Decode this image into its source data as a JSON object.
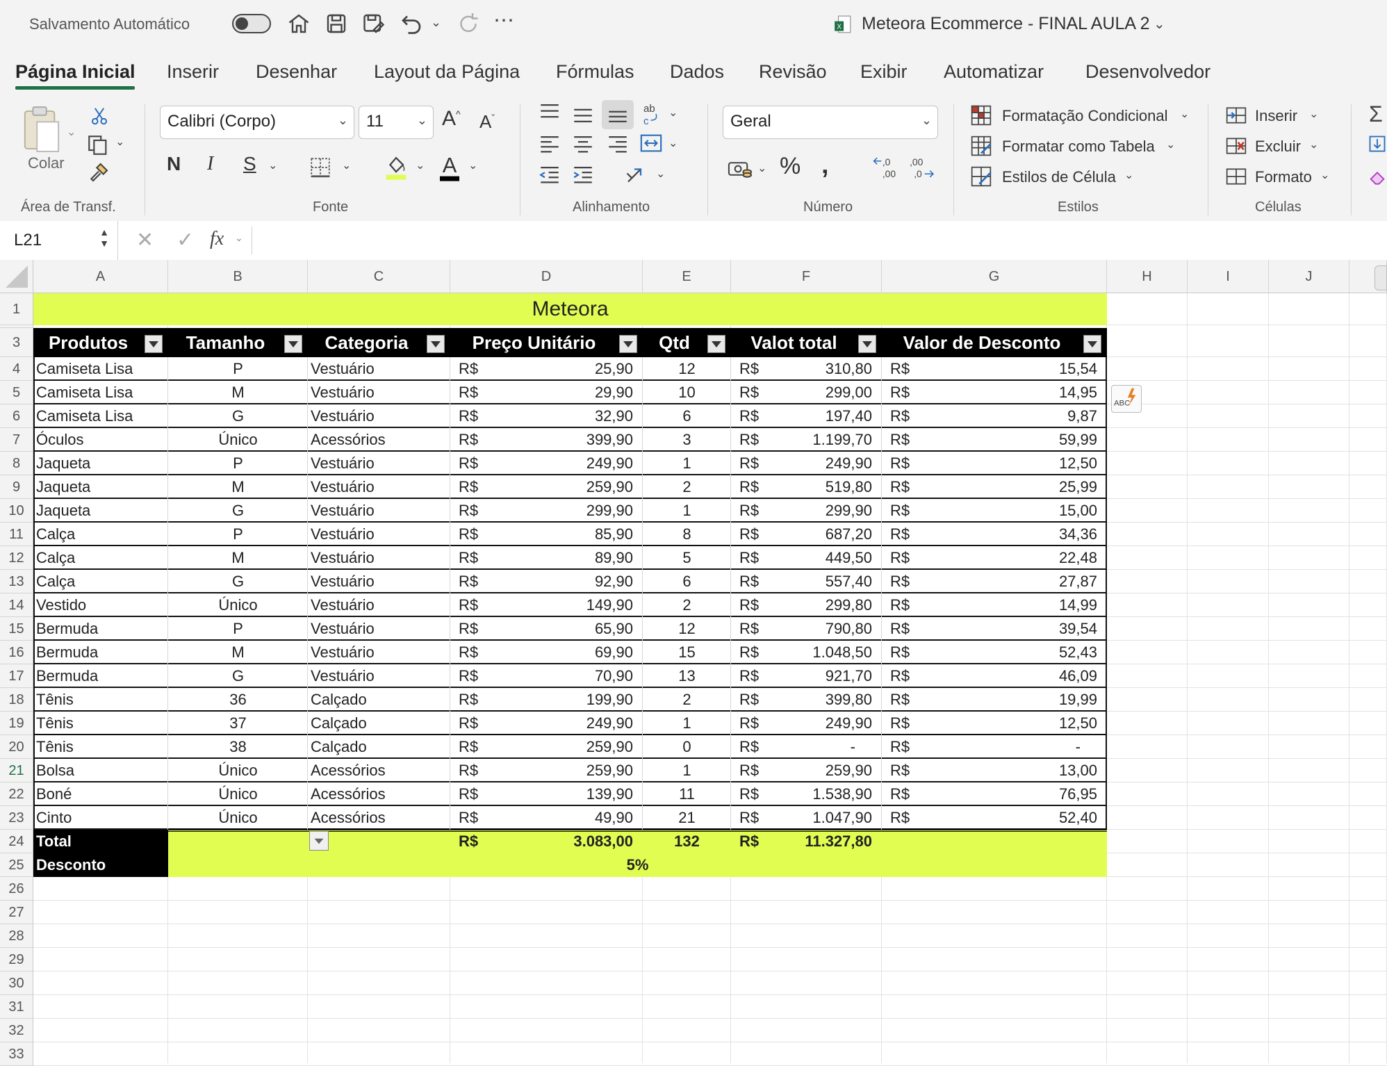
{
  "titlebar": {
    "autosave_label": "Salvamento Automático",
    "doc_title": "Meteora Ecommerce - FINAL AULA 2"
  },
  "tabs": [
    "Página Inicial",
    "Inserir",
    "Desenhar",
    "Layout da Página",
    "Fórmulas",
    "Dados",
    "Revisão",
    "Exibir",
    "Automatizar",
    "Desenvolvedor"
  ],
  "ribbon": {
    "clipboard": {
      "paste_label": "Colar",
      "group_label": "Área de Transf."
    },
    "font": {
      "font_name": "Calibri (Corpo)",
      "font_size": "11",
      "bold": "N",
      "italic": "I",
      "underline": "S",
      "group_label": "Fonte"
    },
    "alignment": {
      "group_label": "Alinhamento"
    },
    "number": {
      "format": "Geral",
      "percent": "%",
      "group_label": "Número"
    },
    "styles": {
      "conditional": "Formatação Condicional",
      "as_table": "Formatar como Tabela",
      "cell_styles": "Estilos de Célula",
      "group_label": "Estilos"
    },
    "cells": {
      "insert": "Inserir",
      "delete": "Excluir",
      "format": "Formato",
      "group_label": "Células"
    }
  },
  "formula_bar": {
    "name_box": "L21",
    "fx": "fx",
    "formula": ""
  },
  "sheet": {
    "columns": [
      "A",
      "B",
      "C",
      "D",
      "E",
      "F",
      "G",
      "H",
      "I",
      "J"
    ],
    "title": "Meteora",
    "headers": [
      "Produtos",
      "Tamanho",
      "Categoria",
      "Preço Unitário",
      "Qtd",
      "Valot total",
      "Valor de Desconto"
    ],
    "currency": "R$",
    "rows": [
      {
        "row": "4",
        "produto": "Camiseta Lisa",
        "tamanho": "P",
        "categoria": "Vestuário",
        "preco": "25,90",
        "qtd": "12",
        "total": "310,80",
        "desconto": "15,54"
      },
      {
        "row": "5",
        "produto": "Camiseta Lisa",
        "tamanho": "M",
        "categoria": "Vestuário",
        "preco": "29,90",
        "qtd": "10",
        "total": "299,00",
        "desconto": "14,95"
      },
      {
        "row": "6",
        "produto": "Camiseta Lisa",
        "tamanho": "G",
        "categoria": "Vestuário",
        "preco": "32,90",
        "qtd": "6",
        "total": "197,40",
        "desconto": "9,87"
      },
      {
        "row": "7",
        "produto": "Óculos",
        "tamanho": "Único",
        "categoria": "Acessórios",
        "preco": "399,90",
        "qtd": "3",
        "total": "1.199,70",
        "desconto": "59,99"
      },
      {
        "row": "8",
        "produto": "Jaqueta",
        "tamanho": "P",
        "categoria": "Vestuário",
        "preco": "249,90",
        "qtd": "1",
        "total": "249,90",
        "desconto": "12,50"
      },
      {
        "row": "9",
        "produto": "Jaqueta",
        "tamanho": "M",
        "categoria": "Vestuário",
        "preco": "259,90",
        "qtd": "2",
        "total": "519,80",
        "desconto": "25,99"
      },
      {
        "row": "10",
        "produto": "Jaqueta",
        "tamanho": "G",
        "categoria": "Vestuário",
        "preco": "299,90",
        "qtd": "1",
        "total": "299,90",
        "desconto": "15,00"
      },
      {
        "row": "11",
        "produto": "Calça",
        "tamanho": "P",
        "categoria": "Vestuário",
        "preco": "85,90",
        "qtd": "8",
        "total": "687,20",
        "desconto": "34,36"
      },
      {
        "row": "12",
        "produto": "Calça",
        "tamanho": "M",
        "categoria": "Vestuário",
        "preco": "89,90",
        "qtd": "5",
        "total": "449,50",
        "desconto": "22,48"
      },
      {
        "row": "13",
        "produto": "Calça",
        "tamanho": "G",
        "categoria": "Vestuário",
        "preco": "92,90",
        "qtd": "6",
        "total": "557,40",
        "desconto": "27,87"
      },
      {
        "row": "14",
        "produto": "Vestido",
        "tamanho": "Único",
        "categoria": "Vestuário",
        "preco": "149,90",
        "qtd": "2",
        "total": "299,80",
        "desconto": "14,99"
      },
      {
        "row": "15",
        "produto": "Bermuda",
        "tamanho": "P",
        "categoria": "Vestuário",
        "preco": "65,90",
        "qtd": "12",
        "total": "790,80",
        "desconto": "39,54"
      },
      {
        "row": "16",
        "produto": "Bermuda",
        "tamanho": "M",
        "categoria": "Vestuário",
        "preco": "69,90",
        "qtd": "15",
        "total": "1.048,50",
        "desconto": "52,43"
      },
      {
        "row": "17",
        "produto": "Bermuda",
        "tamanho": "G",
        "categoria": "Vestuário",
        "preco": "70,90",
        "qtd": "13",
        "total": "921,70",
        "desconto": "46,09"
      },
      {
        "row": "18",
        "produto": "Tênis",
        "tamanho": "36",
        "categoria": "Calçado",
        "preco": "199,90",
        "qtd": "2",
        "total": "399,80",
        "desconto": "19,99"
      },
      {
        "row": "19",
        "produto": "Tênis",
        "tamanho": "37",
        "categoria": "Calçado",
        "preco": "249,90",
        "qtd": "1",
        "total": "249,90",
        "desconto": "12,50"
      },
      {
        "row": "20",
        "produto": "Tênis",
        "tamanho": "38",
        "categoria": "Calçado",
        "preco": "259,90",
        "qtd": "0",
        "total": "-",
        "desconto": "-"
      },
      {
        "row": "21",
        "produto": "Bolsa",
        "tamanho": "Único",
        "categoria": "Acessórios",
        "preco": "259,90",
        "qtd": "1",
        "total": "259,90",
        "desconto": "13,00"
      },
      {
        "row": "22",
        "produto": "Boné",
        "tamanho": "Único",
        "categoria": "Acessórios",
        "preco": "139,90",
        "qtd": "11",
        "total": "1.538,90",
        "desconto": "76,95"
      },
      {
        "row": "23",
        "produto": "Cinto",
        "tamanho": "Único",
        "categoria": "Acessórios",
        "preco": "49,90",
        "qtd": "21",
        "total": "1.047,90",
        "desconto": "52,40"
      }
    ],
    "total_row": {
      "row": "24",
      "label": "Total",
      "preco": "3.083,00",
      "qtd": "132",
      "total": "11.327,80"
    },
    "discount_row": {
      "row": "25",
      "label": "Desconto",
      "value": "5%"
    },
    "empty_rows": [
      "26",
      "27",
      "28",
      "29",
      "30",
      "31",
      "32",
      "33"
    ],
    "title_row": "1",
    "header_row": "3"
  },
  "colors": {
    "accent_green": "#1e7145",
    "highlight": "#e2fd52",
    "header_black": "#000000"
  }
}
